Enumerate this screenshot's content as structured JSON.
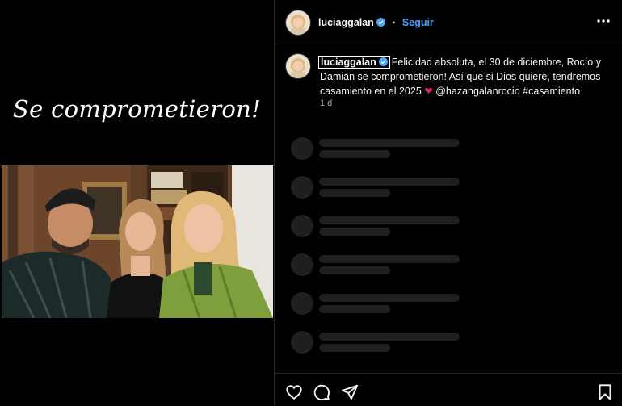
{
  "media": {
    "overlay_text": "Se comprometieron!"
  },
  "post": {
    "username": "luciaggalan",
    "follow_label": "Seguir",
    "separator": "•",
    "caption": "Felicidad absoluta, el 30 de diciembre, Rocío y Damián se comprometieron! Así que si Dios quiere, tendremos casamiento en el 2025",
    "mention": "@hazangalanrocio",
    "hashtag": "#casamiento",
    "time": "1 d"
  },
  "colors": {
    "background": "#000000",
    "accent": "#4aa3f7",
    "heart": "#e0245e",
    "skeleton": "#1f1f1f"
  },
  "icons": {
    "verified": "verified-badge-icon",
    "more": "more-options-icon",
    "like": "heart-outline-icon",
    "comment": "comment-icon",
    "share": "paper-plane-icon",
    "save": "bookmark-icon"
  }
}
